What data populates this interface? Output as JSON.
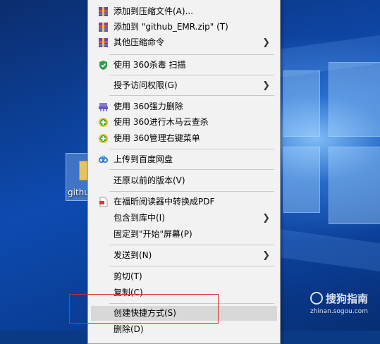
{
  "desktop": {
    "icon_label": "githu"
  },
  "menu": {
    "items": [
      {
        "label": "添加到压缩文件(A)...",
        "icon": "archive-icon",
        "submenu": false
      },
      {
        "label": "添加到 \"github_EMR.zip\" (T)",
        "icon": "archive-icon",
        "submenu": false
      },
      {
        "label": "其他压缩命令",
        "icon": "archive-icon",
        "submenu": true
      },
      {
        "label": "使用 360杀毒 扫描",
        "icon": "shield-icon",
        "submenu": false
      },
      {
        "label": "授予访问权限(G)",
        "icon": "",
        "submenu": true
      },
      {
        "label": "使用 360强力删除",
        "icon": "shredder-icon",
        "submenu": false
      },
      {
        "label": "使用 360进行木马云查杀",
        "icon": "plus-shield-icon",
        "submenu": false
      },
      {
        "label": "使用 360管理右键菜单",
        "icon": "plus-shield-icon",
        "submenu": false
      },
      {
        "label": "上传到百度网盘",
        "icon": "cloud-icon",
        "submenu": false
      },
      {
        "label": "还原以前的版本(V)",
        "icon": "",
        "submenu": false
      },
      {
        "label": "在福昕阅读器中转换成PDF",
        "icon": "pdf-icon",
        "submenu": false
      },
      {
        "label": "包含到库中(I)",
        "icon": "",
        "submenu": true
      },
      {
        "label": "固定到\"开始\"屏幕(P)",
        "icon": "",
        "submenu": false
      },
      {
        "label": "发送到(N)",
        "icon": "",
        "submenu": true
      },
      {
        "label": "剪切(T)",
        "icon": "",
        "submenu": false
      },
      {
        "label": "复制(C)",
        "icon": "",
        "submenu": false
      },
      {
        "label": "创建快捷方式(S)",
        "icon": "",
        "submenu": false,
        "highlighted": true
      },
      {
        "label": "删除(D)",
        "icon": "",
        "submenu": false
      }
    ]
  },
  "watermark": {
    "title": "搜狗指南",
    "url": "zhinan.sogou.com"
  },
  "colors": {
    "menu_bg": "#f2f2f2",
    "highlight": "#d8d8d8",
    "annotation_box": "#d42a2a"
  }
}
